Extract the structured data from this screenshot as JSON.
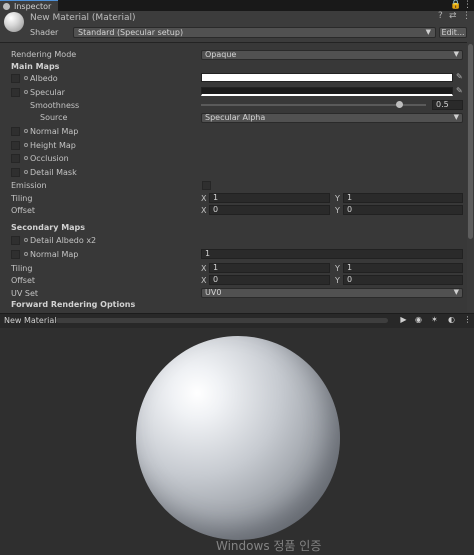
{
  "window": {
    "tab_label": "Inspector",
    "tab_icons": [
      "lock-icon",
      "menu-icon"
    ]
  },
  "header": {
    "title": "New Material (Material)",
    "icons": [
      "help-icon",
      "settings-sliders-icon",
      "menu-icon"
    ],
    "shader_label": "Shader",
    "shader_value": "Standard (Specular setup)",
    "edit_label": "Edit..."
  },
  "properties": {
    "rendering_mode_label": "Rendering Mode",
    "rendering_mode_value": "Opaque",
    "main_maps_label": "Main Maps",
    "albedo_label": "Albedo",
    "albedo_color": "#ffffff",
    "specular_label": "Specular",
    "smoothness_label": "Smoothness",
    "smoothness_value": "0.5",
    "smoothness_fraction": 0.5,
    "source_label": "Source",
    "source_value": "Specular Alpha",
    "normal_map_label": "Normal Map",
    "height_map_label": "Height Map",
    "occlusion_label": "Occlusion",
    "detail_mask_label": "Detail Mask",
    "emission_label": "Emission",
    "tiling_label": "Tiling",
    "tiling_x_axis": "X",
    "tiling_x": "1",
    "tiling_y_axis": "Y",
    "tiling_y": "1",
    "offset_label": "Offset",
    "offset_x_axis": "X",
    "offset_x": "0",
    "offset_y_axis": "Y",
    "offset_y": "0",
    "secondary_maps_label": "Secondary Maps",
    "detail_albedo_label": "Detail Albedo x2",
    "sec_normal_map_label": "Normal Map",
    "sec_normal_value": "1",
    "sec_tiling_label": "Tiling",
    "sec_tiling_x_axis": "X",
    "sec_tiling_x": "1",
    "sec_tiling_y_axis": "Y",
    "sec_tiling_y": "1",
    "sec_offset_label": "Offset",
    "sec_offset_x_axis": "X",
    "sec_offset_x": "0",
    "sec_offset_y_axis": "Y",
    "sec_offset_y": "0",
    "uv_set_label": "UV Set",
    "uv_set_value": "UV0",
    "forward_rendering_label": "Forward Rendering Options"
  },
  "preview": {
    "title": "New Material",
    "toolbar_icons": [
      "play-icon",
      "sphere-shape-icon",
      "light-icon",
      "background-sphere-icon",
      "menu-icon"
    ]
  },
  "watermark": "Windows 정품 인증",
  "colors": {
    "panel": "#383838",
    "header": "#3c3c3c",
    "accent": "#4d8fd6"
  }
}
